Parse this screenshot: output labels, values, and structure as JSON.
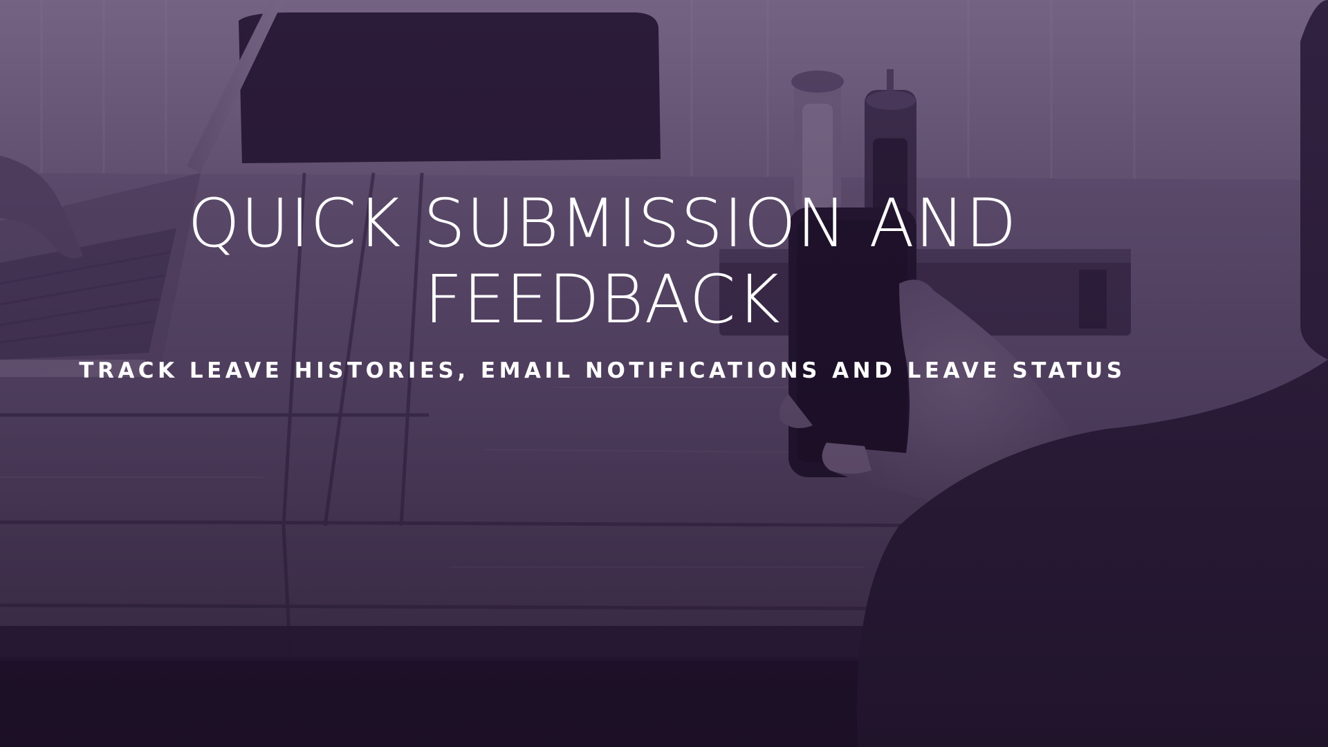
{
  "hero": {
    "headline_line1": "QUICK SUBMISSION AND",
    "headline_line2": "FEEDBACK",
    "subheadline": "TRACK LEAVE HISTORIES, EMAIL NOTIFICATIONS AND LEAVE STATUS"
  },
  "colors": {
    "overlay_tint": "#3e2854",
    "text": "#ffffff",
    "dark_base": "#1d1228"
  }
}
